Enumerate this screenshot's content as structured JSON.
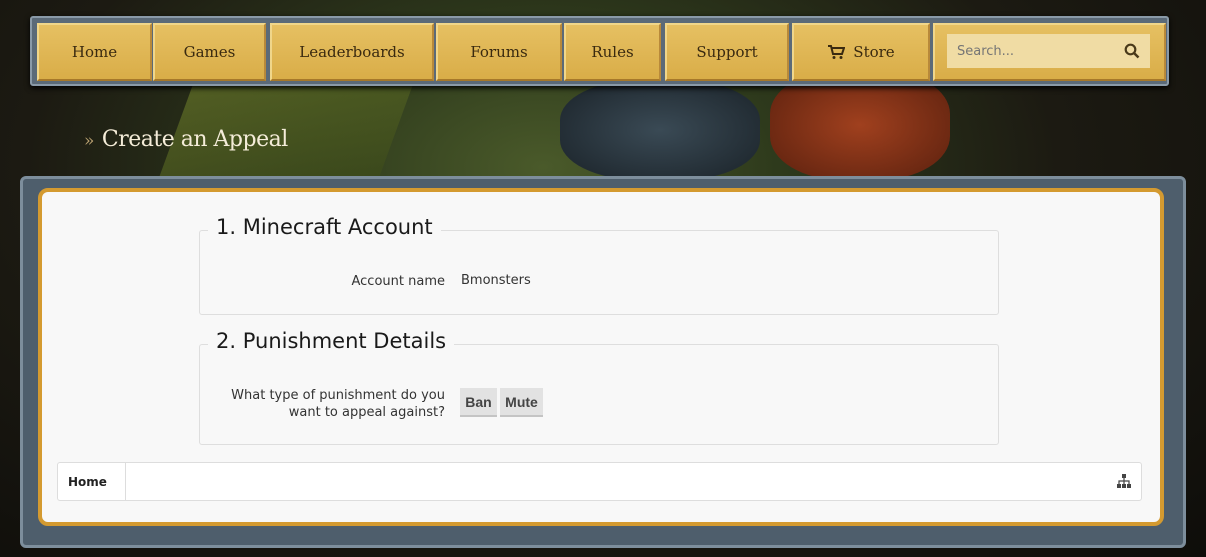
{
  "nav": {
    "items": [
      "Home",
      "Games",
      "Leaderboards",
      "Forums",
      "Rules",
      "Support",
      "Store"
    ],
    "search_placeholder": "Search..."
  },
  "page_title": "Create an Appeal",
  "sections": [
    {
      "legend": "1. Minecraft Account",
      "label": "Account name",
      "value": "Bmonsters"
    },
    {
      "legend": "2. Punishment Details",
      "label_line1": "What type of punishment do you",
      "label_line2": "want to appeal against?",
      "options": [
        "Ban",
        "Mute"
      ]
    }
  ],
  "breadcrumb": {
    "home": "Home"
  }
}
